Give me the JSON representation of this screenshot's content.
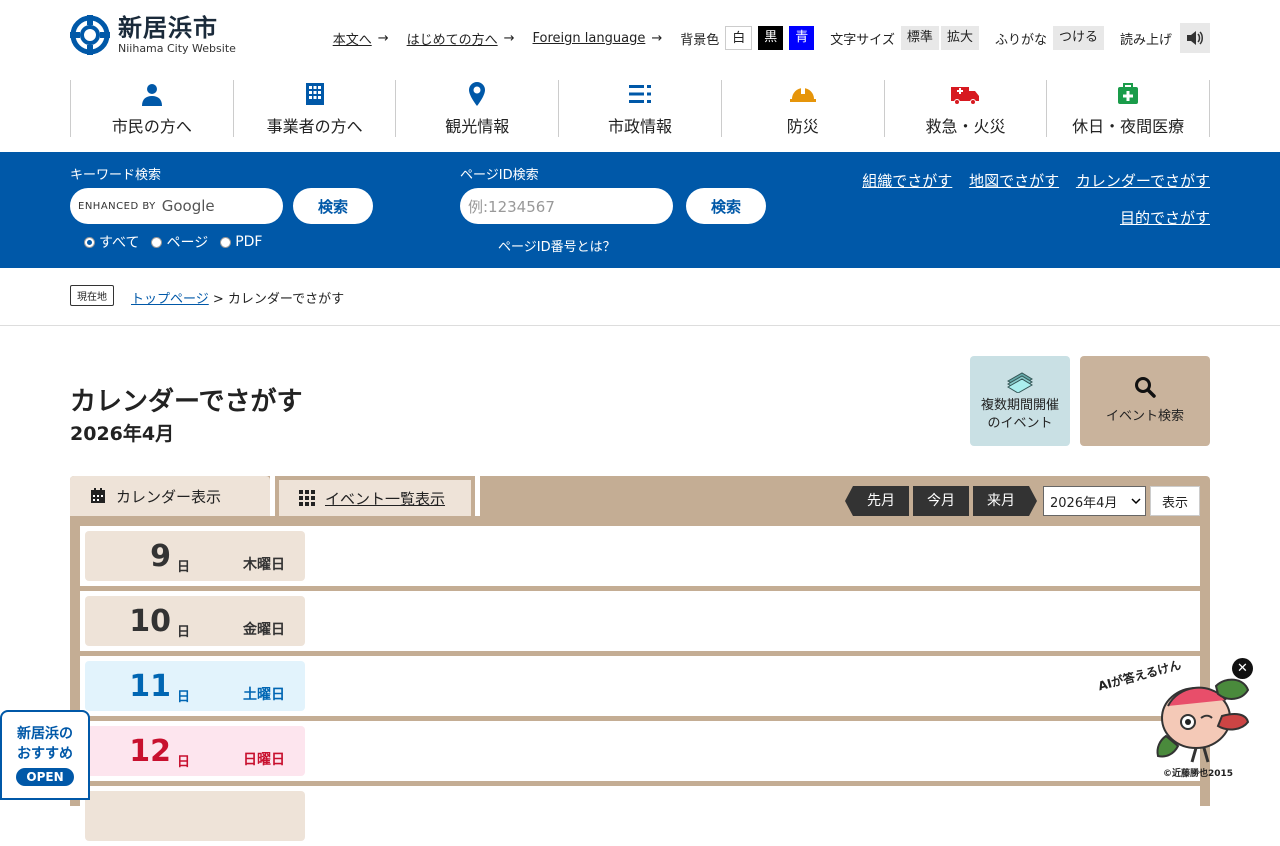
{
  "header": {
    "logo_name": "新居浜市",
    "logo_sub": "Niihama City Website",
    "util": {
      "to_content": "本文へ",
      "beginners": "はじめての方へ",
      "foreign": "Foreign language",
      "arrow": "→",
      "bg_label": "背景色",
      "bg_white": "白",
      "bg_black": "黒",
      "bg_blue": "青",
      "font_label": "文字サイズ",
      "font_std": "標準",
      "font_big": "拡大",
      "furigana_label": "ふりがな",
      "furigana_on": "つける",
      "read_label": "読み上げ"
    },
    "nav": [
      {
        "label": "市民の方へ",
        "icon": "person-icon"
      },
      {
        "label": "事業者の方へ",
        "icon": "building-icon"
      },
      {
        "label": "観光情報",
        "icon": "map-pin-icon"
      },
      {
        "label": "市政情報",
        "icon": "list-icon"
      },
      {
        "label": "防災",
        "icon": "helmet-icon"
      },
      {
        "label": "救急・火災",
        "icon": "ambulance-icon"
      },
      {
        "label": "休日・夜間医療",
        "icon": "medical-kit-icon"
      }
    ]
  },
  "search": {
    "keyword_title": "キーワード検索",
    "google_brand": "ENHANCED BY",
    "google_word": "Google",
    "button": "検索",
    "radios": [
      "すべて",
      "ページ",
      "PDF"
    ],
    "pageid_title": "ページID検索",
    "pageid_placeholder": "例:1234567",
    "pageid_help": "ページID番号とは？",
    "links": [
      "組織でさがす",
      "地図でさがす",
      "カレンダーでさがす",
      "目的でさがす"
    ]
  },
  "breadcrumb": {
    "here": "現在地",
    "top": "トップページ",
    "sep": " > ",
    "current": "カレンダーでさがす"
  },
  "page": {
    "title": "カレンダーでさがす",
    "month": "2026年4月",
    "multi_event_line1": "複数期間開催",
    "multi_event_line2": "のイベント",
    "event_search": "イベント検索"
  },
  "calendar": {
    "tab_calendar": "カレンダー表示",
    "tab_list": "イベント一覧表示",
    "prev": "先月",
    "this": "今月",
    "next": "来月",
    "select_value": "2026年4月",
    "show": "表示",
    "day_unit": "日",
    "days": [
      {
        "num": "9",
        "weekday": "木曜日",
        "type": "weekday"
      },
      {
        "num": "10",
        "weekday": "金曜日",
        "type": "weekday"
      },
      {
        "num": "11",
        "weekday": "土曜日",
        "type": "saturday"
      },
      {
        "num": "12",
        "weekday": "日曜日",
        "type": "sunday"
      }
    ]
  },
  "floating": {
    "reco_line1": "新居浜の",
    "reco_line2": "おすすめ",
    "reco_open": "OPEN",
    "ai_label": "AIが答えるけん",
    "ai_copy": "©近藤勝也2015",
    "close": "✕"
  },
  "colors": {
    "brand_blue": "#0058a8",
    "calendar_tan": "#c4ad94",
    "saturday": "#0066b3",
    "sunday": "#c8102e"
  }
}
